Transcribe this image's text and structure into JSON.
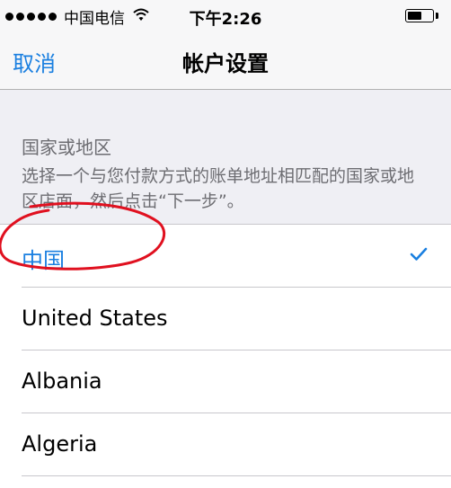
{
  "status_bar": {
    "carrier": "中国电信",
    "time": "下午2:26",
    "battery_level": 0.6
  },
  "nav": {
    "cancel_label": "取消",
    "title": "帐户设置"
  },
  "section": {
    "header": "国家或地区",
    "footer": "选择一个与您付款方式的账单地址相匹配的国家或地区店面，然后点击“下一步”。"
  },
  "countries": [
    {
      "label": "中国",
      "selected": true
    },
    {
      "label": "United States",
      "selected": false
    },
    {
      "label": "Albania",
      "selected": false
    },
    {
      "label": "Algeria",
      "selected": false
    }
  ],
  "colors": {
    "accent": "#1a7fe0",
    "annotation": "#e0101f"
  }
}
